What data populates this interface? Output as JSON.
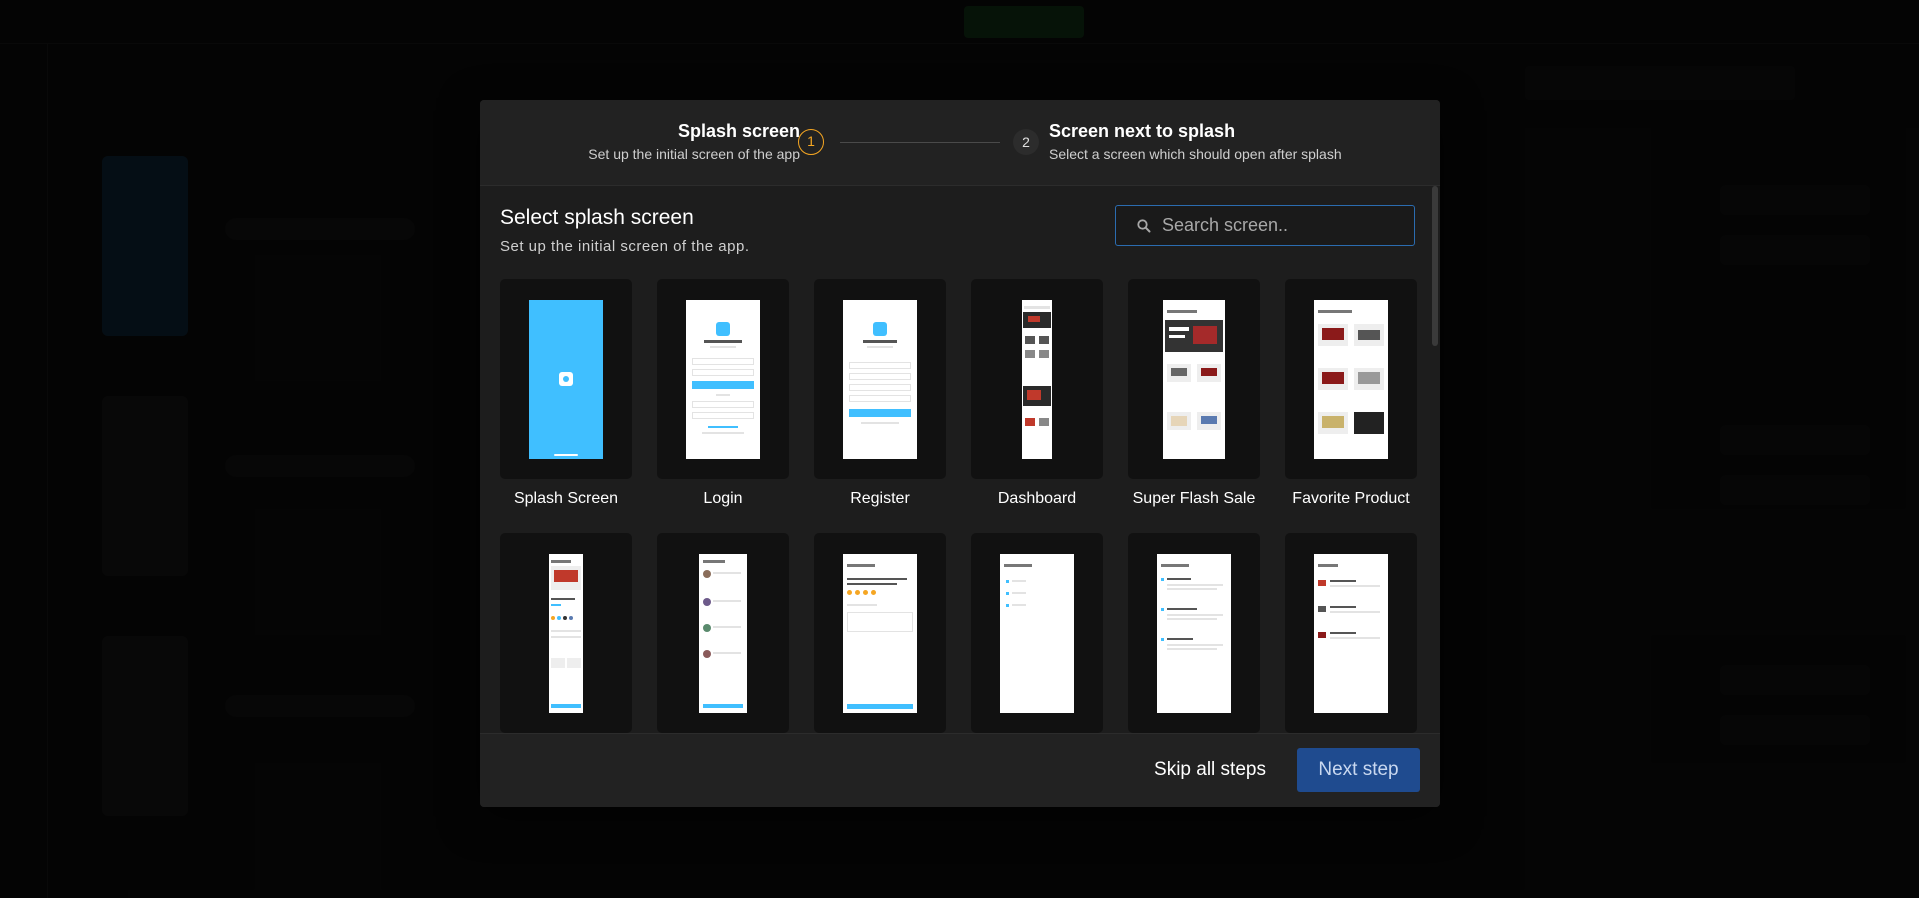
{
  "app": {
    "title": "",
    "accent_color": "#f5a623",
    "primary_color": "#1f4b8f",
    "focus_color": "#2b6cb0"
  },
  "modal": {
    "steps": [
      {
        "number": "1",
        "title": "Splash screen",
        "subtitle": "Set up the initial screen of the app",
        "state": "active"
      },
      {
        "number": "2",
        "title": "Screen next to splash",
        "subtitle": "Select a screen which should open after splash",
        "state": "pending"
      }
    ],
    "section_title": "Select splash screen",
    "section_subtitle": "Set up the initial screen of the app.",
    "search": {
      "placeholder": "Search screen..",
      "value": ""
    },
    "screens": [
      {
        "label": "Splash Screen",
        "preview": "splash"
      },
      {
        "label": "Login",
        "preview": "login"
      },
      {
        "label": "Register",
        "preview": "register"
      },
      {
        "label": "Dashboard",
        "preview": "dashboard"
      },
      {
        "label": "Super Flash Sale",
        "preview": "flash-sale"
      },
      {
        "label": "Favorite Product",
        "preview": "favorite"
      },
      {
        "label": "",
        "preview": "product-detail"
      },
      {
        "label": "",
        "preview": "reviews"
      },
      {
        "label": "",
        "preview": "write-review"
      },
      {
        "label": "",
        "preview": "notification"
      },
      {
        "label": "",
        "preview": "notification-feed"
      },
      {
        "label": "",
        "preview": "offer"
      }
    ],
    "footer": {
      "skip_label": "Skip all steps",
      "next_label": "Next step"
    }
  }
}
